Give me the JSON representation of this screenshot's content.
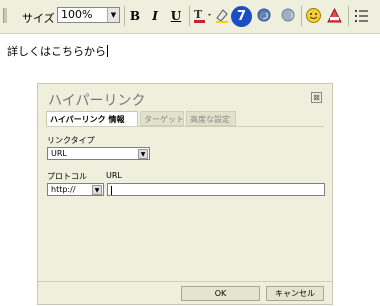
{
  "toolbar": {
    "size_label": "サイズ",
    "zoom_value": "100%",
    "bold_label": "B",
    "italic_label": "I",
    "underline_label": "U",
    "badge_number": "7",
    "icons": [
      "text-color-icon",
      "highlight-icon",
      "hyperlink-icon",
      "unlink-icon",
      "smiley-icon",
      "special-char-icon",
      "list-icon"
    ]
  },
  "editor": {
    "text": "詳しくはこちらから"
  },
  "dialog": {
    "title": "ハイパーリンク",
    "close_glyph": "⊠",
    "tabs": [
      {
        "label": "ハイパーリンク 情報",
        "active": true
      },
      {
        "label": "ターゲット",
        "active": false
      },
      {
        "label": "高度な設定",
        "active": false
      }
    ],
    "link_type_label": "リンクタイプ",
    "link_type_value": "URL",
    "protocol_label": "プロトコル",
    "protocol_value": "http://",
    "url_label": "URL",
    "url_value": "",
    "ok_label": "OK",
    "cancel_label": "キャンセル"
  },
  "colors": {
    "toolbar_bg": "#efefde",
    "dialog_bg": "#efefde",
    "badge": "#1a4fc4"
  }
}
